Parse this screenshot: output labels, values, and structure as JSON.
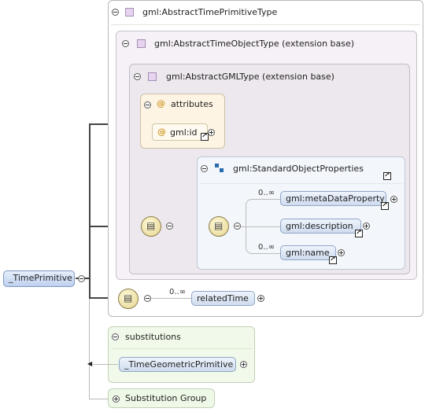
{
  "types": {
    "time_primitive": "gml:AbstractTimePrimitiveType",
    "time_object": "gml:AbstractTimeObjectType (extension base)",
    "gml_type": "gml:AbstractGMLType (extension base)"
  },
  "attributes": {
    "title": "attributes",
    "id": "gml:id"
  },
  "standard_properties": {
    "title": "gml:StandardObjectProperties",
    "items": [
      {
        "label": "gml:metaDataProperty",
        "occurs": "0..∞"
      },
      {
        "label": "gml:description",
        "occurs": ""
      },
      {
        "label": "gml:name",
        "occurs": "0..∞"
      }
    ]
  },
  "root": "_TimePrimitive",
  "related": {
    "label": "relatedTime",
    "occurs": "0..∞"
  },
  "substitutions": {
    "title": "substitutions",
    "item": "_TimeGeometricPrimitive"
  },
  "substitution_group": "Substitution Group"
}
